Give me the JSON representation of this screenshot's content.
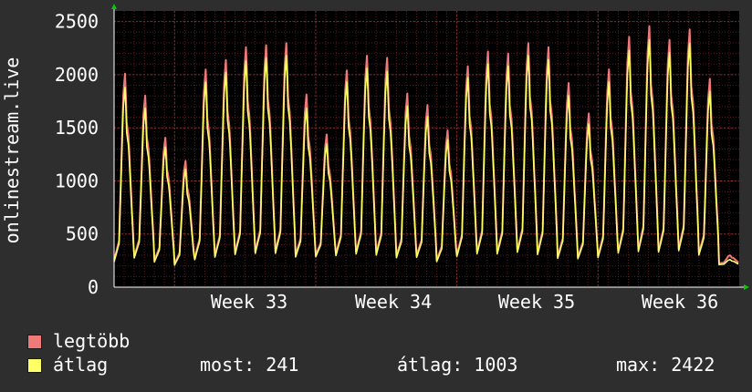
{
  "chart_data": {
    "type": "line",
    "ylabel": "onlinestream.live",
    "ylim": [
      0,
      2600
    ],
    "yticks": [
      0,
      500,
      1000,
      1500,
      2000,
      2500
    ],
    "xticks": [
      "Week 33",
      "Week 34",
      "Week 35",
      "Week 36"
    ],
    "days": 31,
    "series": [
      {
        "name": "legtöbb",
        "color": "#f07a7a",
        "daily_peaks": [
          2030,
          1820,
          1420,
          1200,
          2070,
          2160,
          2280,
          2300,
          2320,
          1830,
          1450,
          2060,
          2200,
          2180,
          1840,
          1730,
          1490,
          2100,
          2240,
          2220,
          2320,
          2280,
          1940,
          1650,
          2070,
          2380,
          2480,
          2350,
          2450,
          1980,
          300
        ],
        "daily_lows": [
          160,
          210,
          190,
          170,
          180,
          200,
          220,
          230,
          230,
          220,
          240,
          220,
          230,
          220,
          210,
          220,
          190,
          210,
          230,
          230,
          240,
          220,
          200,
          210,
          200,
          230,
          240,
          240,
          250,
          230,
          220
        ]
      },
      {
        "name": "átlag",
        "color": "#ffff66",
        "daily_peaks": [
          1900,
          1700,
          1330,
          1120,
          1950,
          2040,
          2150,
          2180,
          2200,
          1700,
          1360,
          1950,
          2080,
          2050,
          1720,
          1620,
          1400,
          1990,
          2120,
          2100,
          2200,
          2160,
          1820,
          1550,
          1950,
          2250,
          2350,
          2230,
          2320,
          1860,
          260
        ],
        "daily_lows": [
          150,
          200,
          180,
          160,
          170,
          190,
          210,
          220,
          220,
          210,
          230,
          210,
          220,
          210,
          200,
          210,
          180,
          200,
          220,
          220,
          230,
          210,
          190,
          200,
          190,
          220,
          230,
          230,
          240,
          220,
          210
        ]
      }
    ]
  },
  "legend": {
    "max_label": "legtöbb",
    "avg_label": "átlag"
  },
  "stats": {
    "now": "most: 241",
    "avg": "átlag: 1003",
    "max": "max: 2422"
  }
}
